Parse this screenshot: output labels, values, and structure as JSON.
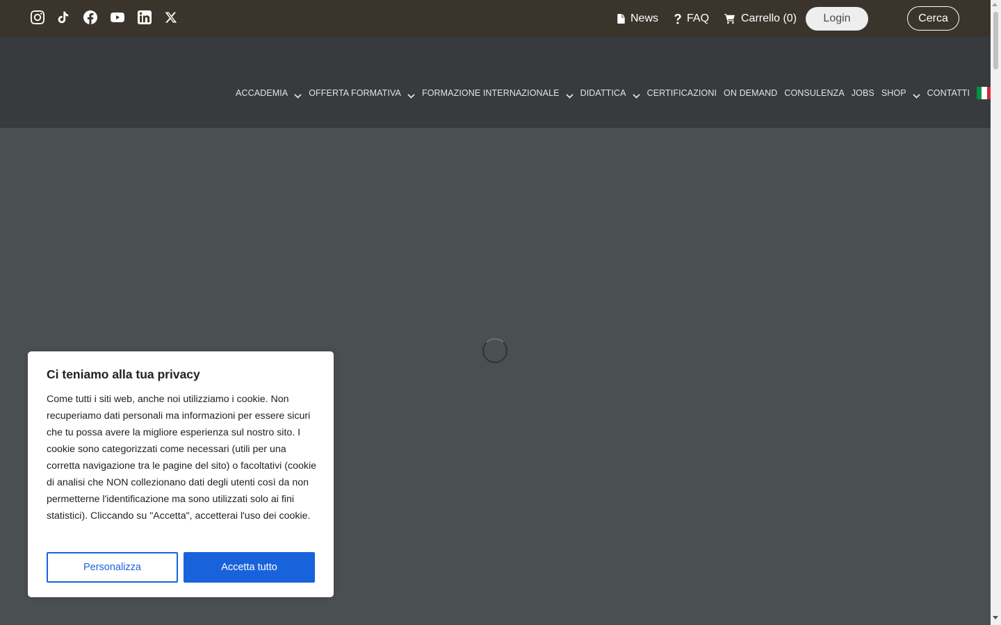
{
  "topbar": {
    "social_icons": [
      "instagram-icon",
      "tiktok-icon",
      "facebook-icon",
      "youtube-icon",
      "linkedin-icon",
      "x-twitter-icon"
    ],
    "links": {
      "news": "News",
      "faq": "FAQ",
      "cart": "Carrello (0)"
    },
    "login_label": "Login",
    "search_label": "Cerca",
    "background": "#3b342d"
  },
  "nav": {
    "items": [
      {
        "label": "ACCADEMIA",
        "has_dropdown": true
      },
      {
        "label": "OFFERTA FORMATIVA",
        "has_dropdown": true
      },
      {
        "label": "FORMAZIONE INTERNAZIONALE",
        "has_dropdown": true
      },
      {
        "label": "DIDATTICA",
        "has_dropdown": true
      },
      {
        "label": "CERTIFICAZIONI",
        "has_dropdown": false
      },
      {
        "label": "ON DEMAND",
        "has_dropdown": false
      },
      {
        "label": "CONSULENZA",
        "has_dropdown": false
      },
      {
        "label": "JOBS",
        "has_dropdown": false
      },
      {
        "label": "SHOP",
        "has_dropdown": true
      },
      {
        "label": "CONTATTI",
        "has_dropdown": false
      }
    ],
    "language_flag": "italy-flag-icon",
    "flag_colors": [
      "#009246",
      "#ffffff",
      "#ce2b37"
    ],
    "background": "#373b3d"
  },
  "main": {
    "loading_indicator": "spinner-icon",
    "background": "#4a4f52"
  },
  "cookie_banner": {
    "title": "Ci teniamo alla tua privacy",
    "text": "Come tutti i siti web, anche noi utilizziamo i cookie. Non recuperiamo dati personali ma informazioni per essere sicuri che tu possa avere la migliore esperienza sul nostro sito. I cookie sono categorizzati come necessari (utili per una corretta navigazione tra le pagine del sito) o facoltativi (cookie di analisi che NON collezionano dati degli utenti così da non permetterne l'identificazione ma sono utilizzati solo ai fini statistici). Cliccando su \"Accetta\", accetterai l'uso dei cookie.",
    "customize_label": "Personalizza",
    "accept_label": "Accetta tutto",
    "accent_color": "#1863dc"
  }
}
